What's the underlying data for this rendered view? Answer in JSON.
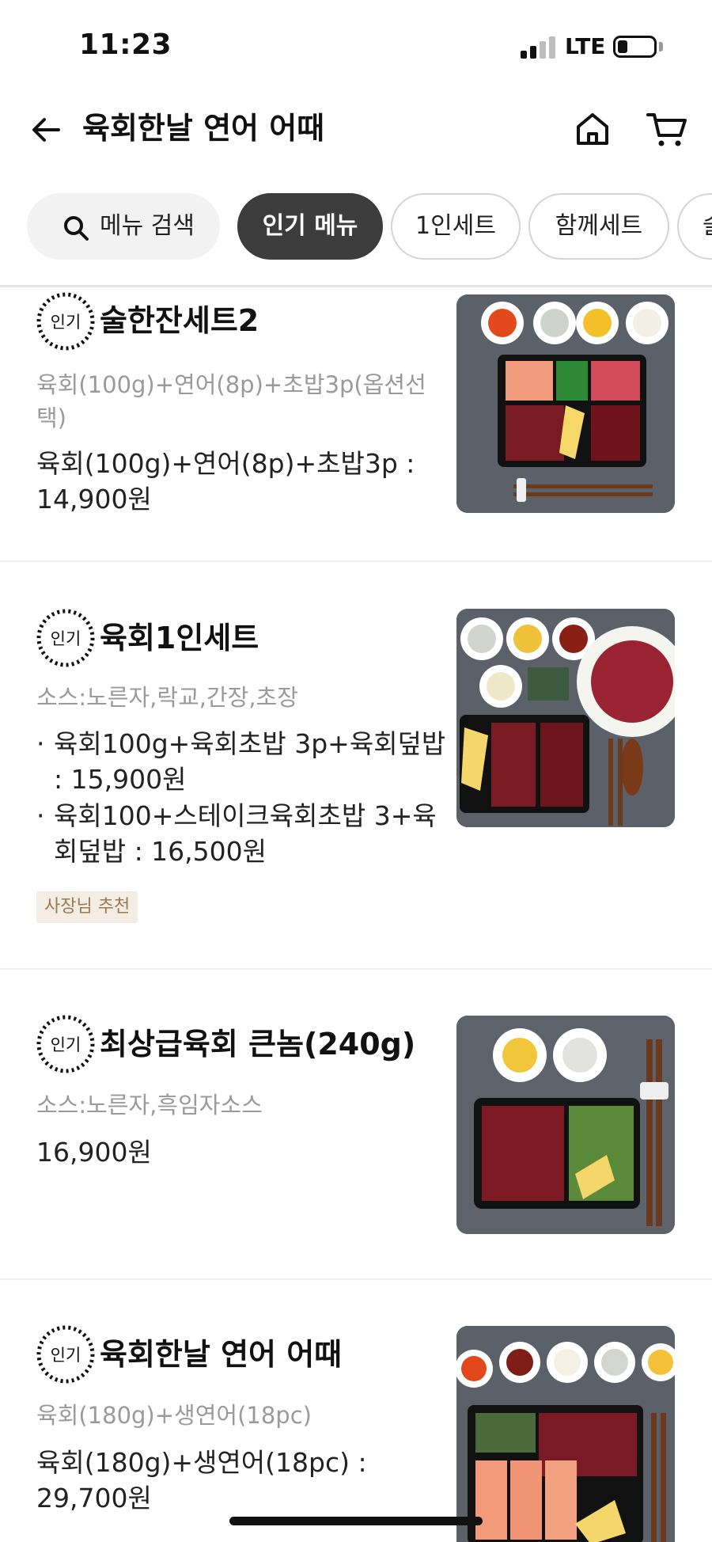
{
  "status_bar": {
    "time": "11:23",
    "network": "LTE"
  },
  "header": {
    "title": "육회한날 연어 어때"
  },
  "tabs": [
    {
      "label": "메뉴 검색"
    },
    {
      "label": "인기 메뉴"
    },
    {
      "label": "1인세트"
    },
    {
      "label": "함께세트"
    },
    {
      "label": "술"
    }
  ],
  "badge_label": "인기",
  "menu": [
    {
      "name": "술한잔세트2",
      "desc": "육회(100g)+연어(8p)+초밥3p(옵션선택)",
      "price": "육회(100g)+연어(8p)+초밥3p : 14,900원"
    },
    {
      "name": "육회1인세트",
      "desc": "소스:노른자,락교,간장,초장",
      "bullets": [
        "육회100g+육회초밥 3p+육회덮밥 : 15,900원",
        "육회100+스테이크육회초밥 3+육회덮밥 : 16,500원"
      ],
      "tag": "사장님 추천"
    },
    {
      "name": "최상급육회 큰놈(240g)",
      "desc": "소스:노른자,흑임자소스",
      "price": "16,900원"
    },
    {
      "name": "육회한날 연어 어때",
      "desc": "육회(180g)+생연어(18pc)",
      "price": "육회(180g)+생연어(18pc) : 29,700원"
    }
  ]
}
